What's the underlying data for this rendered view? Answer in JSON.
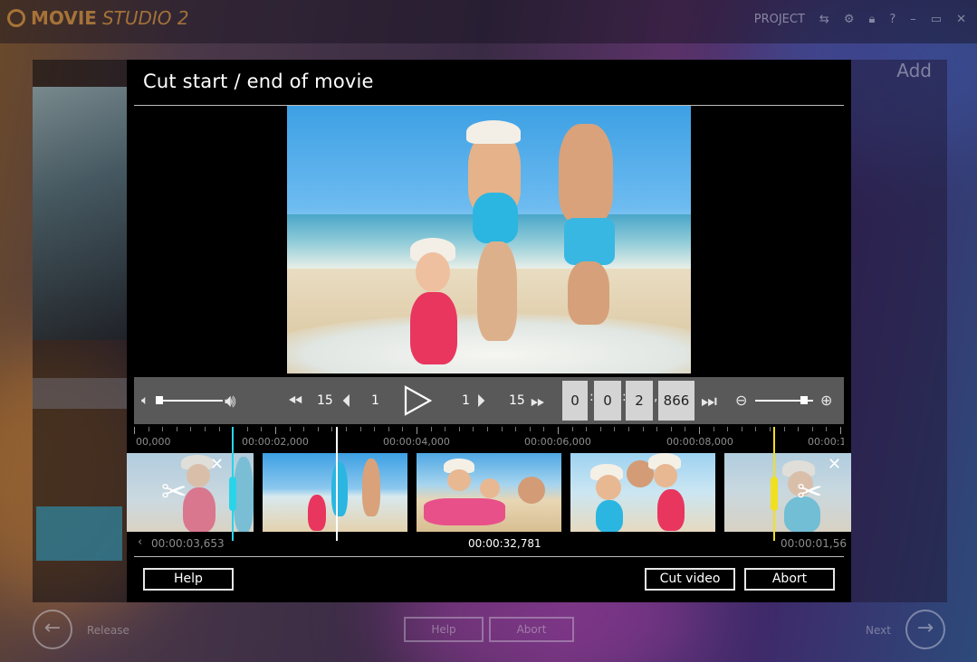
{
  "background_app": {
    "logo_movie": "MOVIE",
    "logo_studio": "STUDIO 2",
    "project_label": "PROJECT",
    "add_label": "Add",
    "bottom_buttons": [
      "Help",
      "Abort"
    ],
    "back_label": "Release",
    "next_label": "Next",
    "top_icons": [
      "undo-redo-icon",
      "settings-icon",
      "lock-icon",
      "help-icon",
      "minimize-icon",
      "maximize-icon",
      "close-icon"
    ]
  },
  "dialog": {
    "title": "Cut start / end of movie",
    "controls": {
      "skip_back_large": "15",
      "skip_back_small": "1",
      "skip_fwd_small": "1",
      "skip_fwd_large": "15",
      "time_hours": "0",
      "time_minutes": "0",
      "time_seconds": "2",
      "time_millis": "866",
      "volume_level": 0.05,
      "zoom_level": 0.85
    },
    "ruler_labels": [
      "00,000",
      "00:00:02,000",
      "00:00:04,000",
      "00:00:06,000",
      "00:00:08,000",
      "00:00:1"
    ],
    "readouts": {
      "left": "00:00:03,653",
      "center": "00:00:32,781",
      "right": "00:00:01,56"
    },
    "buttons": {
      "help": "Help",
      "cut_video": "Cut video",
      "abort": "Abort"
    },
    "colors": {
      "start_marker": "#2ad4e8",
      "end_marker": "#f0e020",
      "playhead": "#ffffff"
    }
  }
}
